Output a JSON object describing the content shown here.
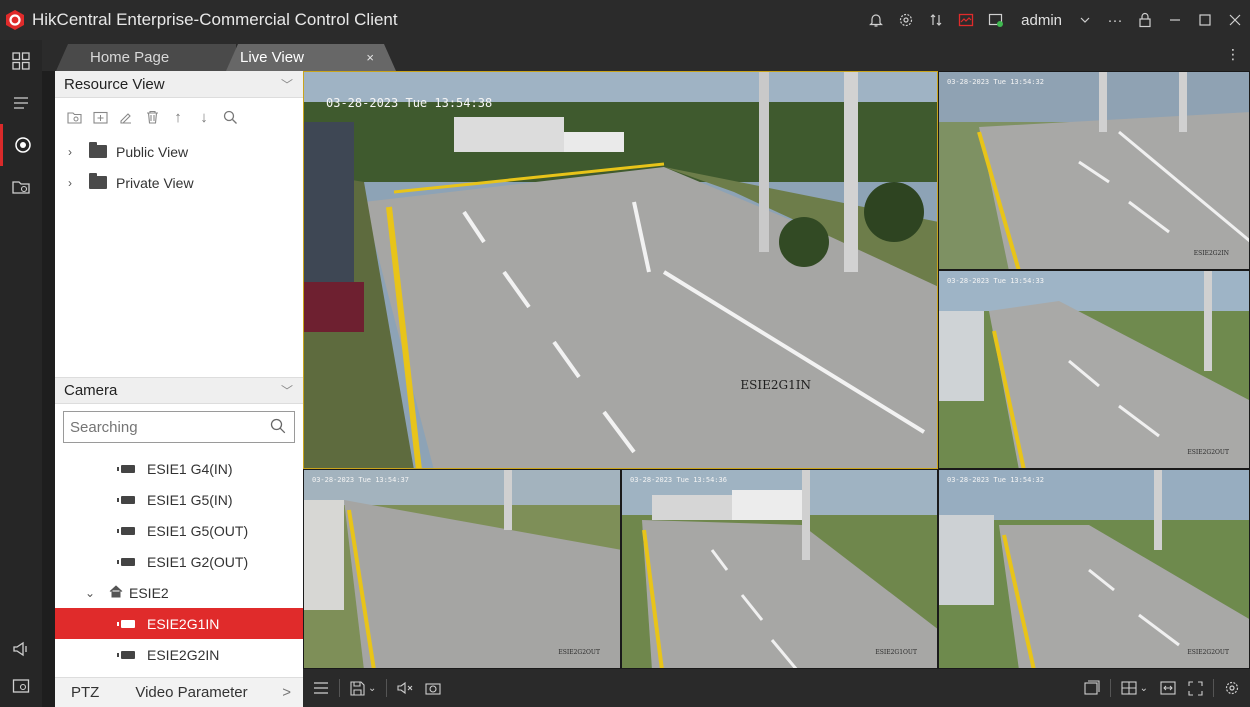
{
  "app": {
    "title": "HikCentral Enterprise-Commercial Control Client",
    "brand_color": "#e02b2b"
  },
  "titlebar": {
    "user": "admin",
    "user_menu_icon": "chevron-down-icon"
  },
  "tabs": [
    {
      "label": "Home Page",
      "active": false
    },
    {
      "label": "Live View",
      "active": true,
      "close": "×"
    }
  ],
  "resource_view": {
    "header": "Resource View",
    "items": [
      {
        "label": "Public View"
      },
      {
        "label": "Private View"
      }
    ]
  },
  "camera": {
    "header": "Camera",
    "search_placeholder": "Searching",
    "list": [
      {
        "label": "ESIE1 G4(IN)"
      },
      {
        "label": "ESIE1 G5(IN)"
      },
      {
        "label": "ESIE1 G5(OUT)"
      },
      {
        "label": "ESIE1 G2(OUT)"
      }
    ],
    "group": {
      "label": "ESIE2"
    },
    "group_list": [
      {
        "label": "ESIE2G1IN",
        "selected": true
      },
      {
        "label": "ESIE2G2IN",
        "selected": false
      }
    ]
  },
  "bottom_panel": {
    "ptz": "PTZ",
    "video_parameter": "Video Parameter",
    "more": ">"
  },
  "tiles": [
    {
      "timestamp": "03-28-2023 Tue 13:54:38",
      "label": "ESIE2G1IN"
    },
    {
      "timestamp": "03-28-2023 Tue 13:54:32",
      "label": "ESIE2G2IN"
    },
    {
      "timestamp": "03-28-2023 Tue 13:54:33",
      "label": "ESIE2G2OUT"
    },
    {
      "timestamp": "03-28-2023 Tue 13:54:37",
      "label": "ESIE2G2OUT"
    },
    {
      "timestamp": "03-28-2023 Tue 13:54:36",
      "label": "ESIE2G1OUT"
    },
    {
      "timestamp": "03-28-2023 Tue 13:54:32",
      "label": "ESIE2G2OUT"
    }
  ]
}
